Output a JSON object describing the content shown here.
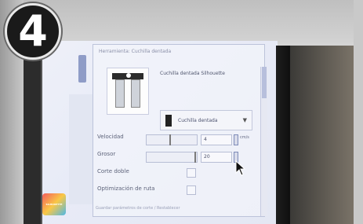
{
  "step_badge": "4",
  "panel": {
    "header": "Herramienta: Cuchilla dentada",
    "tool_name": "Cuchilla dentada Silhouette",
    "tool_select": "Cuchilla dentada",
    "rows": [
      {
        "label": "Velocidad",
        "value": "4",
        "unit": "cm/s"
      },
      {
        "label": "Grosor",
        "value": "20"
      },
      {
        "label": "Corte doble"
      },
      {
        "label": "Optimización de ruta"
      }
    ],
    "footnote": "Guardar parámetros de corte / Restablecer"
  },
  "logo_text": "SILHOUETTE"
}
